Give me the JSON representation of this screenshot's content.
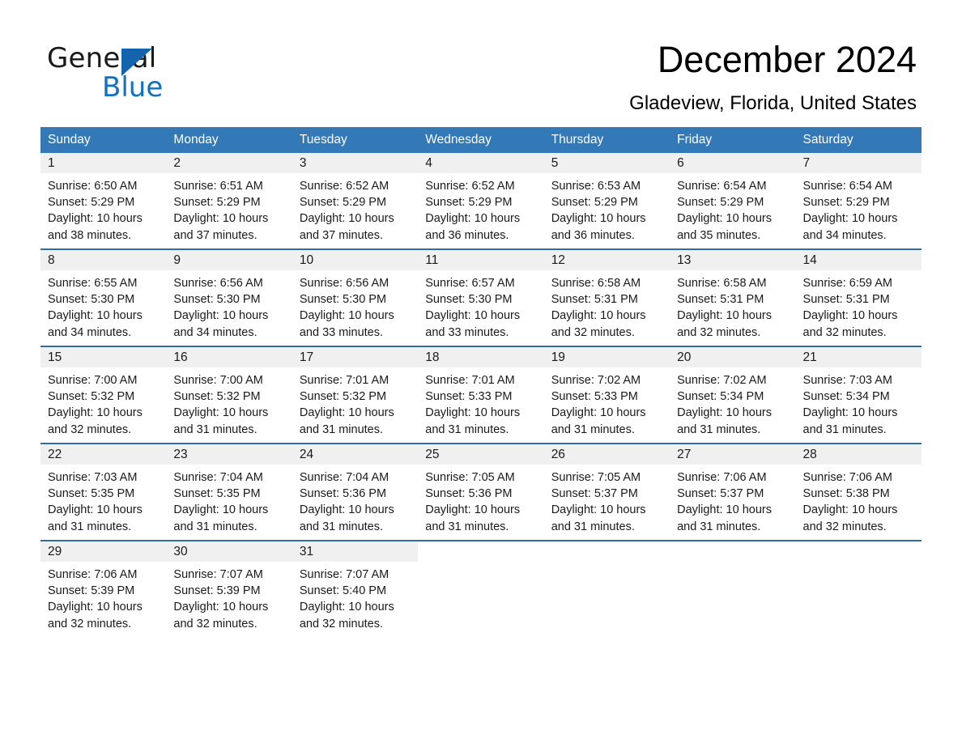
{
  "brand": {
    "name_part1": "General",
    "name_part2": "Blue",
    "logo_icon": "triangle-icon",
    "accent_color": "#1170c0"
  },
  "header": {
    "title": "December 2024",
    "location": "Gladeview, Florida, United States"
  },
  "theme": {
    "header_row_bg": "#3479b7",
    "row_divider": "#2e6da4",
    "daynum_bg": "#f0f0f0",
    "text": "#1a1a1a"
  },
  "weekday_headers": [
    "Sunday",
    "Monday",
    "Tuesday",
    "Wednesday",
    "Thursday",
    "Friday",
    "Saturday"
  ],
  "weeks": [
    [
      {
        "day": "1",
        "sunrise": "Sunrise: 6:50 AM",
        "sunset": "Sunset: 5:29 PM",
        "daylight_line1": "Daylight: 10 hours",
        "daylight_line2": "and 38 minutes."
      },
      {
        "day": "2",
        "sunrise": "Sunrise: 6:51 AM",
        "sunset": "Sunset: 5:29 PM",
        "daylight_line1": "Daylight: 10 hours",
        "daylight_line2": "and 37 minutes."
      },
      {
        "day": "3",
        "sunrise": "Sunrise: 6:52 AM",
        "sunset": "Sunset: 5:29 PM",
        "daylight_line1": "Daylight: 10 hours",
        "daylight_line2": "and 37 minutes."
      },
      {
        "day": "4",
        "sunrise": "Sunrise: 6:52 AM",
        "sunset": "Sunset: 5:29 PM",
        "daylight_line1": "Daylight: 10 hours",
        "daylight_line2": "and 36 minutes."
      },
      {
        "day": "5",
        "sunrise": "Sunrise: 6:53 AM",
        "sunset": "Sunset: 5:29 PM",
        "daylight_line1": "Daylight: 10 hours",
        "daylight_line2": "and 36 minutes."
      },
      {
        "day": "6",
        "sunrise": "Sunrise: 6:54 AM",
        "sunset": "Sunset: 5:29 PM",
        "daylight_line1": "Daylight: 10 hours",
        "daylight_line2": "and 35 minutes."
      },
      {
        "day": "7",
        "sunrise": "Sunrise: 6:54 AM",
        "sunset": "Sunset: 5:29 PM",
        "daylight_line1": "Daylight: 10 hours",
        "daylight_line2": "and 34 minutes."
      }
    ],
    [
      {
        "day": "8",
        "sunrise": "Sunrise: 6:55 AM",
        "sunset": "Sunset: 5:30 PM",
        "daylight_line1": "Daylight: 10 hours",
        "daylight_line2": "and 34 minutes."
      },
      {
        "day": "9",
        "sunrise": "Sunrise: 6:56 AM",
        "sunset": "Sunset: 5:30 PM",
        "daylight_line1": "Daylight: 10 hours",
        "daylight_line2": "and 34 minutes."
      },
      {
        "day": "10",
        "sunrise": "Sunrise: 6:56 AM",
        "sunset": "Sunset: 5:30 PM",
        "daylight_line1": "Daylight: 10 hours",
        "daylight_line2": "and 33 minutes."
      },
      {
        "day": "11",
        "sunrise": "Sunrise: 6:57 AM",
        "sunset": "Sunset: 5:30 PM",
        "daylight_line1": "Daylight: 10 hours",
        "daylight_line2": "and 33 minutes."
      },
      {
        "day": "12",
        "sunrise": "Sunrise: 6:58 AM",
        "sunset": "Sunset: 5:31 PM",
        "daylight_line1": "Daylight: 10 hours",
        "daylight_line2": "and 32 minutes."
      },
      {
        "day": "13",
        "sunrise": "Sunrise: 6:58 AM",
        "sunset": "Sunset: 5:31 PM",
        "daylight_line1": "Daylight: 10 hours",
        "daylight_line2": "and 32 minutes."
      },
      {
        "day": "14",
        "sunrise": "Sunrise: 6:59 AM",
        "sunset": "Sunset: 5:31 PM",
        "daylight_line1": "Daylight: 10 hours",
        "daylight_line2": "and 32 minutes."
      }
    ],
    [
      {
        "day": "15",
        "sunrise": "Sunrise: 7:00 AM",
        "sunset": "Sunset: 5:32 PM",
        "daylight_line1": "Daylight: 10 hours",
        "daylight_line2": "and 32 minutes."
      },
      {
        "day": "16",
        "sunrise": "Sunrise: 7:00 AM",
        "sunset": "Sunset: 5:32 PM",
        "daylight_line1": "Daylight: 10 hours",
        "daylight_line2": "and 31 minutes."
      },
      {
        "day": "17",
        "sunrise": "Sunrise: 7:01 AM",
        "sunset": "Sunset: 5:32 PM",
        "daylight_line1": "Daylight: 10 hours",
        "daylight_line2": "and 31 minutes."
      },
      {
        "day": "18",
        "sunrise": "Sunrise: 7:01 AM",
        "sunset": "Sunset: 5:33 PM",
        "daylight_line1": "Daylight: 10 hours",
        "daylight_line2": "and 31 minutes."
      },
      {
        "day": "19",
        "sunrise": "Sunrise: 7:02 AM",
        "sunset": "Sunset: 5:33 PM",
        "daylight_line1": "Daylight: 10 hours",
        "daylight_line2": "and 31 minutes."
      },
      {
        "day": "20",
        "sunrise": "Sunrise: 7:02 AM",
        "sunset": "Sunset: 5:34 PM",
        "daylight_line1": "Daylight: 10 hours",
        "daylight_line2": "and 31 minutes."
      },
      {
        "day": "21",
        "sunrise": "Sunrise: 7:03 AM",
        "sunset": "Sunset: 5:34 PM",
        "daylight_line1": "Daylight: 10 hours",
        "daylight_line2": "and 31 minutes."
      }
    ],
    [
      {
        "day": "22",
        "sunrise": "Sunrise: 7:03 AM",
        "sunset": "Sunset: 5:35 PM",
        "daylight_line1": "Daylight: 10 hours",
        "daylight_line2": "and 31 minutes."
      },
      {
        "day": "23",
        "sunrise": "Sunrise: 7:04 AM",
        "sunset": "Sunset: 5:35 PM",
        "daylight_line1": "Daylight: 10 hours",
        "daylight_line2": "and 31 minutes."
      },
      {
        "day": "24",
        "sunrise": "Sunrise: 7:04 AM",
        "sunset": "Sunset: 5:36 PM",
        "daylight_line1": "Daylight: 10 hours",
        "daylight_line2": "and 31 minutes."
      },
      {
        "day": "25",
        "sunrise": "Sunrise: 7:05 AM",
        "sunset": "Sunset: 5:36 PM",
        "daylight_line1": "Daylight: 10 hours",
        "daylight_line2": "and 31 minutes."
      },
      {
        "day": "26",
        "sunrise": "Sunrise: 7:05 AM",
        "sunset": "Sunset: 5:37 PM",
        "daylight_line1": "Daylight: 10 hours",
        "daylight_line2": "and 31 minutes."
      },
      {
        "day": "27",
        "sunrise": "Sunrise: 7:06 AM",
        "sunset": "Sunset: 5:37 PM",
        "daylight_line1": "Daylight: 10 hours",
        "daylight_line2": "and 31 minutes."
      },
      {
        "day": "28",
        "sunrise": "Sunrise: 7:06 AM",
        "sunset": "Sunset: 5:38 PM",
        "daylight_line1": "Daylight: 10 hours",
        "daylight_line2": "and 32 minutes."
      }
    ],
    [
      {
        "day": "29",
        "sunrise": "Sunrise: 7:06 AM",
        "sunset": "Sunset: 5:39 PM",
        "daylight_line1": "Daylight: 10 hours",
        "daylight_line2": "and 32 minutes."
      },
      {
        "day": "30",
        "sunrise": "Sunrise: 7:07 AM",
        "sunset": "Sunset: 5:39 PM",
        "daylight_line1": "Daylight: 10 hours",
        "daylight_line2": "and 32 minutes."
      },
      {
        "day": "31",
        "sunrise": "Sunrise: 7:07 AM",
        "sunset": "Sunset: 5:40 PM",
        "daylight_line1": "Daylight: 10 hours",
        "daylight_line2": "and 32 minutes."
      },
      {
        "day": "",
        "sunrise": "",
        "sunset": "",
        "daylight_line1": "",
        "daylight_line2": ""
      },
      {
        "day": "",
        "sunrise": "",
        "sunset": "",
        "daylight_line1": "",
        "daylight_line2": ""
      },
      {
        "day": "",
        "sunrise": "",
        "sunset": "",
        "daylight_line1": "",
        "daylight_line2": ""
      },
      {
        "day": "",
        "sunrise": "",
        "sunset": "",
        "daylight_line1": "",
        "daylight_line2": ""
      }
    ]
  ]
}
